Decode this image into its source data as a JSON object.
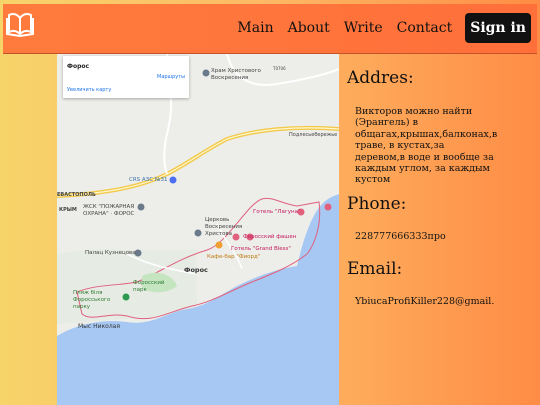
{
  "header": {
    "logo_icon": "open-book-icon",
    "nav": [
      "Main",
      "About",
      "Write",
      "Contact"
    ],
    "signin_label": "Sign in"
  },
  "map": {
    "card": {
      "title": "Форос",
      "route_label": "Маршруты",
      "enlarge_label": "Увеличить карту"
    },
    "labels": {
      "temple": "Храм Христового Воскресения",
      "gas": "CRS АЗС №31",
      "fire": "ЖСК \"ПОЖАРНАЯ ОХРАНА\" · ФОРОС",
      "church": "Церковь Воскресения Христова",
      "hotel_laguna": "Готель \"Лагуна\"",
      "forossky_fashion": "Форосский фашен",
      "hotel_grand": "Готель \"Grand Bless\"",
      "cafe": "Кафе-бар \"Фиорд\"",
      "palace": "Палац Кузнецова",
      "foros": "Форос",
      "park": "Форосский парк",
      "beach": "Пляж біля Форосського парку",
      "cape": "Мыс Николая",
      "krym": "КРЫМ",
      "sevastopol": "ЕВАСТОПОЛЬ",
      "sevastopol2": "СЕВАСТОПОЛЬ",
      "road": "Подлесьебережье",
      "m": "Т0706"
    }
  },
  "contact": {
    "address_heading": "Addres:",
    "address_text": "Викторов можно найти (Эрангель) в общагах,крышах,балконах,в траве, в кустах,за деревом,в воде и вообще за каждым углом, за каждым кустом",
    "phone_heading": "Phone:",
    "phone_text": "228777666333про",
    "email_heading": "Email:",
    "email_text": "YbiucaProfiKiller228@gmail."
  },
  "colors": {
    "header": "#ff7b3d",
    "signin_bg": "#111111",
    "sea": "#a7c8f2",
    "road": "#f2c94c"
  }
}
